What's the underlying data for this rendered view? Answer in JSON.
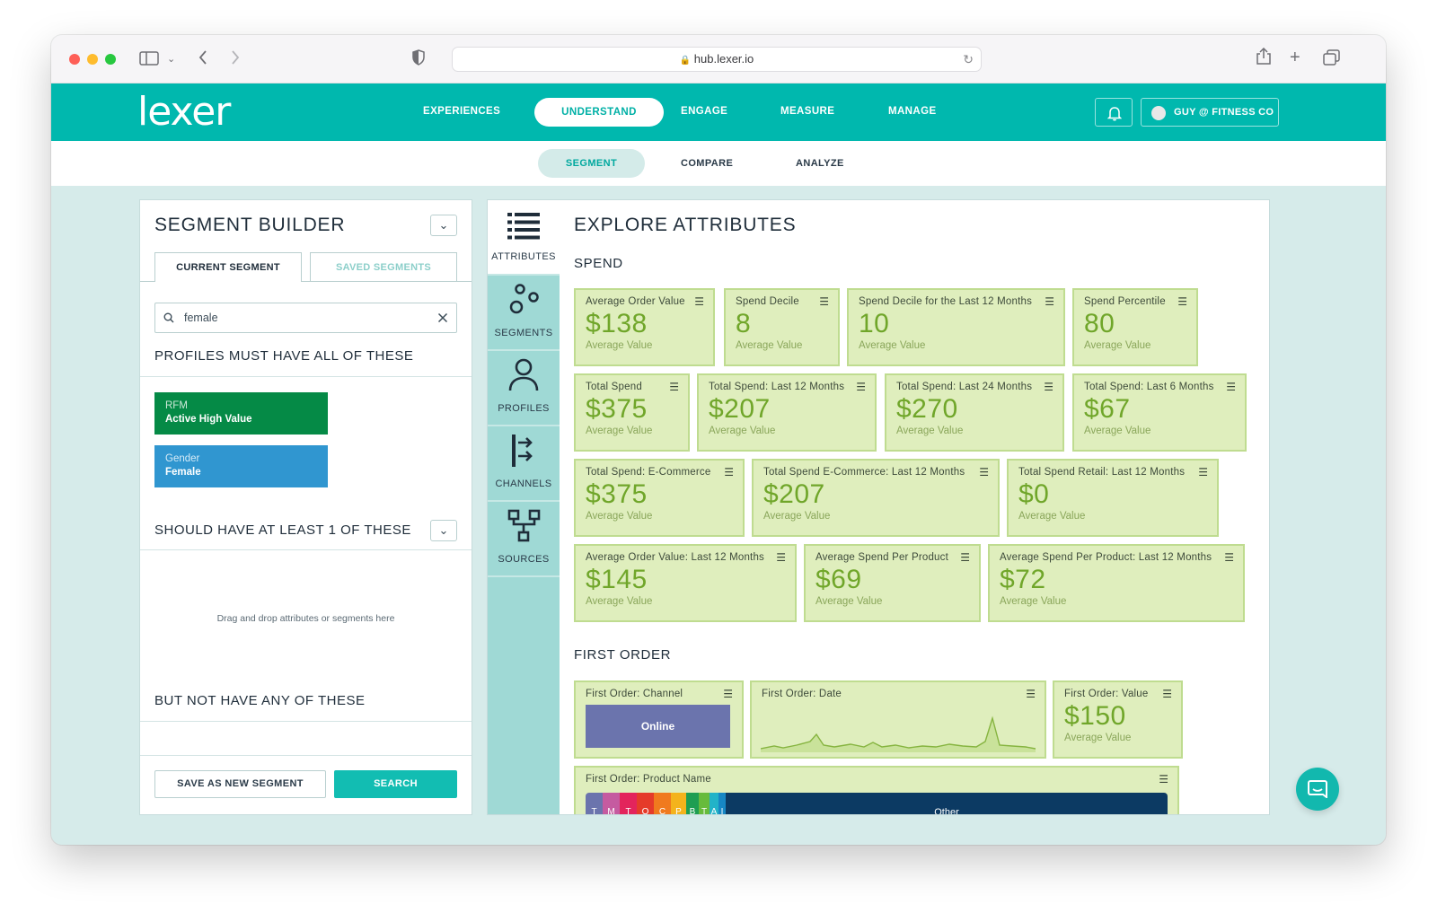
{
  "browser": {
    "url": "hub.lexer.io"
  },
  "brand": {
    "logo": "lexer"
  },
  "nav": {
    "items": [
      "EXPERIENCES",
      "UNDERSTAND",
      "ENGAGE",
      "MEASURE",
      "MANAGE"
    ],
    "user": "GUY @ FITNESS CO"
  },
  "subnav": {
    "items": [
      "SEGMENT",
      "COMPARE",
      "ANALYZE"
    ]
  },
  "segment_builder": {
    "title": "SEGMENT BUILDER",
    "tab_current": "CURRENT SEGMENT",
    "tab_saved": "SAVED SEGMENTS",
    "search_value": "female",
    "must_title": "PROFILES MUST HAVE ALL OF THESE",
    "chips": [
      {
        "category": "RFM",
        "value": "Active High Value",
        "color": "#058a46"
      },
      {
        "category": "Gender",
        "value": "Female",
        "color": "#3096d0"
      }
    ],
    "should_title": "SHOULD HAVE AT LEAST 1 OF THESE",
    "drop_hint": "Drag and drop attributes or segments here",
    "not_title": "BUT NOT HAVE ANY OF THESE",
    "save_button": "SAVE AS NEW SEGMENT",
    "search_button": "SEARCH"
  },
  "sidebar": {
    "items": [
      {
        "label": "ATTRIBUTES",
        "icon": "list-icon"
      },
      {
        "label": "SEGMENTS",
        "icon": "segments-icon"
      },
      {
        "label": "PROFILES",
        "icon": "person-icon"
      },
      {
        "label": "CHANNELS",
        "icon": "channels-icon"
      },
      {
        "label": "SOURCES",
        "icon": "sources-icon"
      }
    ]
  },
  "explore": {
    "title": "EXPLORE ATTRIBUTES",
    "spend_title": "SPEND",
    "spend_cards": [
      {
        "title": "Average Order Value",
        "value": "$138",
        "sub": "Average Value"
      },
      {
        "title": "Spend Decile",
        "value": "8",
        "sub": "Average Value"
      },
      {
        "title": "Spend Decile for the Last 12 Months",
        "value": "10",
        "sub": "Average Value"
      },
      {
        "title": "Spend Percentile",
        "value": "80",
        "sub": "Average Value"
      },
      {
        "title": "Total Spend",
        "value": "$375",
        "sub": "Average Value"
      },
      {
        "title": "Total Spend: Last 12 Months",
        "value": "$207",
        "sub": "Average Value"
      },
      {
        "title": "Total Spend: Last 24 Months",
        "value": "$270",
        "sub": "Average Value"
      },
      {
        "title": "Total Spend: Last 6 Months",
        "value": "$67",
        "sub": "Average Value"
      },
      {
        "title": "Total Spend: E-Commerce",
        "value": "$375",
        "sub": "Average Value"
      },
      {
        "title": "Total Spend E-Commerce: Last 12 Months",
        "value": "$207",
        "sub": "Average Value"
      },
      {
        "title": "Total Spend Retail: Last 12 Months",
        "value": "$0",
        "sub": "Average Value"
      },
      {
        "title": "Average Order Value: Last 12 Months",
        "value": "$145",
        "sub": "Average Value"
      },
      {
        "title": "Average Spend Per Product",
        "value": "$69",
        "sub": "Average Value"
      },
      {
        "title": "Average Spend Per Product: Last 12 Months",
        "value": "$72",
        "sub": "Average Value"
      }
    ],
    "first_order_title": "FIRST ORDER",
    "first_order": {
      "channel_title": "First Order: Channel",
      "channel_bar": "Online",
      "date_title": "First Order: Date",
      "value_title": "First Order: Value",
      "value": "$150",
      "value_sub": "Average Value",
      "product_title": "First Order: Product Name",
      "product_letters": [
        "T",
        "M",
        "T",
        "O",
        "C",
        "P",
        "B",
        "T",
        "A",
        "I"
      ],
      "product_other": "Other"
    }
  },
  "colors": {
    "teal": "#00b8ae",
    "card_bg": "#dfeebd",
    "card_value": "#70a62a",
    "online_bar": "#6b74ad",
    "other_bar": "#0c3a63"
  }
}
